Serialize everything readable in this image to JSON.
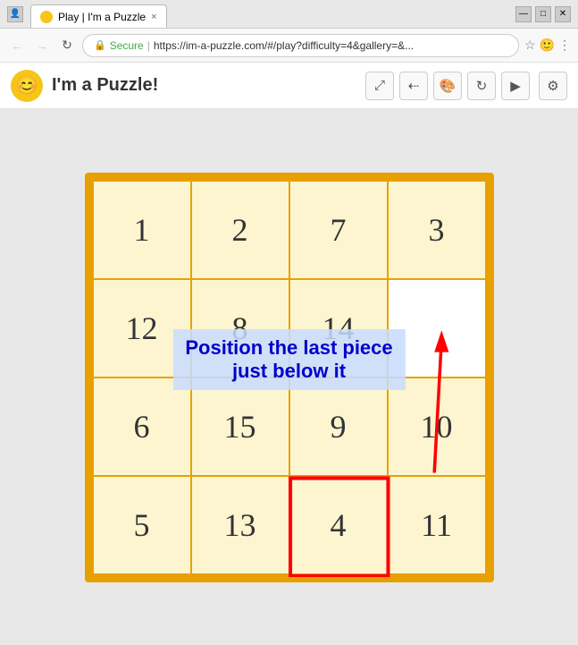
{
  "titlebar": {
    "tab_title": "Play | I'm a Puzzle",
    "tab_close": "×"
  },
  "addressbar": {
    "secure_label": "Secure",
    "url": "https://im-a-puzzle.com/#/play?difficulty=4&gallery=&...",
    "back_label": "←",
    "forward_label": "→",
    "refresh_label": "↻"
  },
  "appheader": {
    "logo_emoji": "😊",
    "title": "I'm a Puzzle!",
    "btn_expand": "⤢",
    "btn_share": "≪",
    "btn_palette": "◉",
    "btn_refresh": "↻",
    "btn_play": "▶",
    "btn_gear": "⚙"
  },
  "puzzle": {
    "cells": [
      {
        "value": "1",
        "empty": false,
        "row": 0,
        "col": 0
      },
      {
        "value": "2",
        "empty": false,
        "row": 0,
        "col": 1
      },
      {
        "value": "7",
        "empty": false,
        "row": 0,
        "col": 2
      },
      {
        "value": "3",
        "empty": false,
        "row": 0,
        "col": 3
      },
      {
        "value": "12",
        "empty": false,
        "row": 1,
        "col": 0
      },
      {
        "value": "8",
        "empty": false,
        "row": 1,
        "col": 1
      },
      {
        "value": "14",
        "empty": false,
        "row": 1,
        "col": 2
      },
      {
        "value": "",
        "empty": true,
        "row": 1,
        "col": 3
      },
      {
        "value": "6",
        "empty": false,
        "row": 2,
        "col": 0
      },
      {
        "value": "15",
        "empty": false,
        "row": 2,
        "col": 1
      },
      {
        "value": "9",
        "empty": false,
        "row": 2,
        "col": 2
      },
      {
        "value": "10",
        "empty": false,
        "row": 2,
        "col": 3
      },
      {
        "value": "5",
        "empty": false,
        "row": 3,
        "col": 0
      },
      {
        "value": "13",
        "empty": false,
        "row": 3,
        "col": 1
      },
      {
        "value": "4",
        "empty": false,
        "row": 3,
        "col": 2,
        "red_border": true
      },
      {
        "value": "11",
        "empty": false,
        "row": 3,
        "col": 3
      }
    ],
    "hint": {
      "line1": "Position the last piece",
      "line2": "just below it"
    }
  }
}
